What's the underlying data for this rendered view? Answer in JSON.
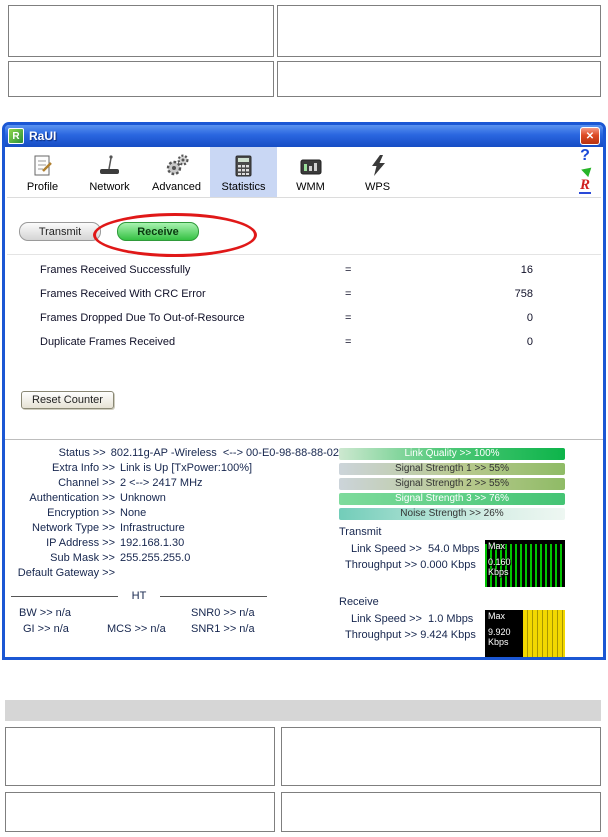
{
  "app": {
    "title": "RaUI"
  },
  "titlebar": {
    "close": "✕"
  },
  "toolbar": {
    "items": [
      {
        "label": "Profile"
      },
      {
        "label": "Network"
      },
      {
        "label": "Advanced"
      },
      {
        "label": "Statistics",
        "selected": true
      },
      {
        "label": "WMM"
      },
      {
        "label": "WPS"
      }
    ],
    "help": "?",
    "logo": "R"
  },
  "tabs": {
    "transmit": "Transmit",
    "receive": "Receive"
  },
  "stats": {
    "rows": [
      {
        "label": "Frames Received Successfully",
        "eq": "=",
        "value": "16"
      },
      {
        "label": "Frames Received With CRC Error",
        "eq": "=",
        "value": "758"
      },
      {
        "label": "Frames Dropped Due To Out-of-Resource",
        "eq": "=",
        "value": "0"
      },
      {
        "label": "Duplicate Frames Received",
        "eq": "=",
        "value": "0"
      }
    ],
    "reset_button": "Reset Counter"
  },
  "status": {
    "rows": [
      {
        "label": "Status >>",
        "value": "802.11g-AP -Wireless  <--> 00-E0-98-88-88-02"
      },
      {
        "label": "Extra Info >>",
        "value": "Link is Up [TxPower:100%]"
      },
      {
        "label": "Channel >>",
        "value": "2 <--> 2417 MHz"
      },
      {
        "label": "Authentication >>",
        "value": "Unknown"
      },
      {
        "label": "Encryption >>",
        "value": "None"
      },
      {
        "label": "Network Type >>",
        "value": "Infrastructure"
      },
      {
        "label": "IP Address >>",
        "value": "192.168.1.30"
      },
      {
        "label": "Sub Mask >>",
        "value": "255.255.255.0"
      },
      {
        "label": "Default Gateway >>",
        "value": ""
      }
    ],
    "ht": {
      "label": "HT",
      "bw": "BW >> n/a",
      "snr0": "SNR0 >> n/a",
      "gi": "GI >> n/a",
      "mcs": "MCS >> n/a",
      "snr1": "SNR1 >> n/a"
    }
  },
  "gauges": {
    "bars": [
      {
        "text": "Link Quality >> 100%",
        "percent": 100
      },
      {
        "text": "Signal Strength 1 >> 55%",
        "percent": 55
      },
      {
        "text": "Signal Strength 2 >> 55%",
        "percent": 55
      },
      {
        "text": "Signal Strength 3 >> 76%",
        "percent": 76
      },
      {
        "text": "Noise Strength >> 26%",
        "percent": 26
      }
    ]
  },
  "transmit": {
    "title": "Transmit",
    "link_speed": "Link Speed >>  54.0 Mbps",
    "throughput": "Throughput >> 0.000 Kbps",
    "chart_max": "Max",
    "chart_value": "0.160 Kbps"
  },
  "receive": {
    "title": "Receive",
    "link_speed": "Link Speed >>  1.0 Mbps",
    "throughput": "Throughput >> 9.424 Kbps",
    "chart_max": "Max",
    "chart_value": "9.920 Kbps"
  },
  "colors": {
    "titlebar_blue": "#1b57d4",
    "selected_tab_blue": "#c9d7f4",
    "receive_tab_green": "#35c143",
    "annotation_red": "#e01818",
    "transmit_chart_green": "#00c400",
    "receive_chart_yellow": "#f2d800",
    "link_quality_green": "#0db44a"
  }
}
